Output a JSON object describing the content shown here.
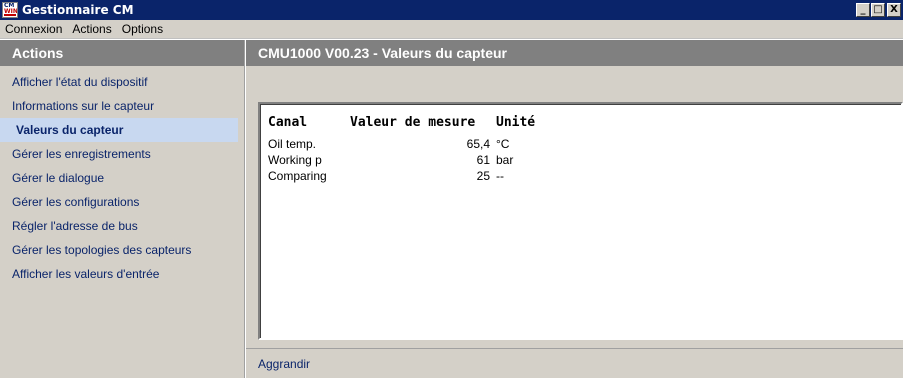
{
  "window": {
    "title": "Gestionnaire CM",
    "icon": "cm-win-app-icon",
    "buttons": [
      "_",
      "□",
      "X"
    ]
  },
  "menubar": {
    "items": [
      "Connexion",
      "Actions",
      "Options"
    ]
  },
  "sidebar": {
    "header": "Actions",
    "items": [
      {
        "label": "Afficher l'état du dispositif"
      },
      {
        "label": "Informations sur le capteur"
      },
      {
        "label": "Valeurs du capteur",
        "active": true
      },
      {
        "label": "Gérer les enregistrements"
      },
      {
        "label": "Gérer le dialogue"
      },
      {
        "label": "Gérer les configurations"
      },
      {
        "label": "Régler l'adresse de bus"
      },
      {
        "label": "Gérer les topologies des capteurs"
      },
      {
        "label": "Afficher les valeurs d'entrée"
      }
    ]
  },
  "main": {
    "header": "CMU1000 V00.23 - Valeurs du capteur",
    "table": {
      "columns": [
        "Canal",
        "Valeur de mesure",
        "Unité"
      ],
      "rows": [
        {
          "canal": "Oil temp.",
          "valeur": "65,4",
          "unite": "°C"
        },
        {
          "canal": "Working p",
          "valeur": "61",
          "unite": "bar"
        },
        {
          "canal": "Comparing",
          "valeur": "25",
          "unite": "--"
        }
      ]
    },
    "footer_link": "Aggrandir"
  },
  "colors": {
    "titlebar": "#0a246a",
    "header_gray": "#808080",
    "link_blue": "#0a246a",
    "active_item_bg": "#c8d8f0"
  }
}
